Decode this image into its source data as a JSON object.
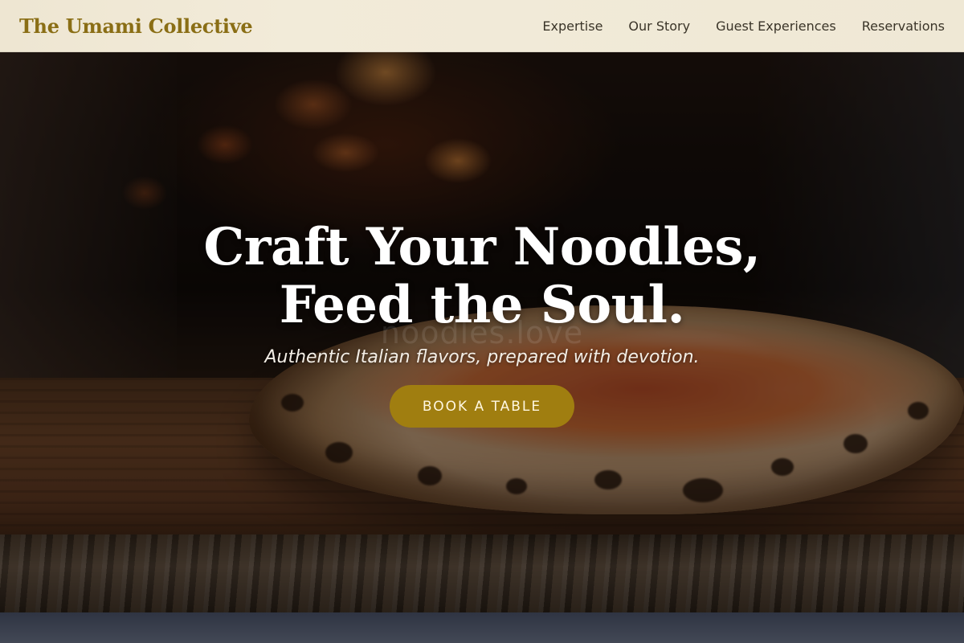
{
  "header": {
    "brand": "The Umami Collective",
    "nav": [
      {
        "label": "Expertise"
      },
      {
        "label": "Our Story"
      },
      {
        "label": "Guest Experiences"
      },
      {
        "label": "Reservations"
      }
    ]
  },
  "hero": {
    "title_line1": "Craft Your Noodles,",
    "title_line2": "Feed the Soul.",
    "watermark": "noodles.love",
    "subtitle": "Authentic Italian flavors, prepared with devotion.",
    "cta_label": "BOOK A TABLE",
    "background_image": "wood-fired pizza on wooden board in front of oven"
  },
  "colors": {
    "brand": "#8a6e15",
    "cta_background": "#a07e10",
    "navbar_background": "#efe8d5"
  }
}
